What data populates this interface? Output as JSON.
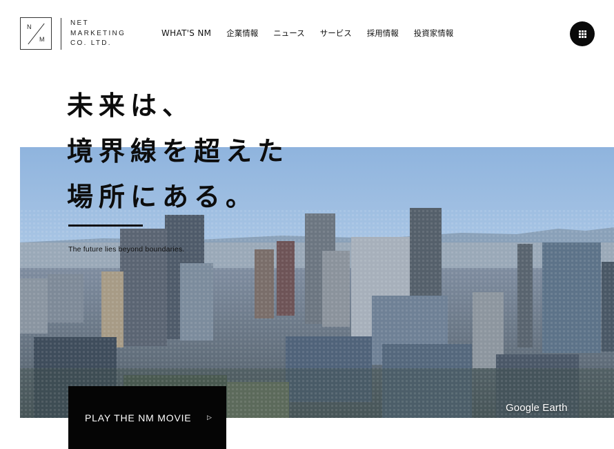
{
  "brand": {
    "mark_n": "N",
    "mark_m": "M",
    "lines": [
      "NET",
      "MARKETING",
      "CO. LTD."
    ]
  },
  "nav": {
    "items": [
      "WHAT'S NM",
      "企業情報",
      "ニュース",
      "サービス",
      "採用情報",
      "投資家情報"
    ]
  },
  "menu_button": {
    "icon": "grid-menu-icon"
  },
  "hero": {
    "headline": [
      "未来は、",
      "境界線を超えた",
      "場所にある。"
    ],
    "subcopy": "The future lies beyond boundaries.",
    "image_credit": "Google Earth",
    "movie_button_label": "PLAY THE NM MOVIE",
    "movie_button_icon": "▷"
  },
  "colors": {
    "text": "#111111",
    "background": "#ffffff",
    "button": "#050505",
    "sky": "#8fb4de"
  }
}
